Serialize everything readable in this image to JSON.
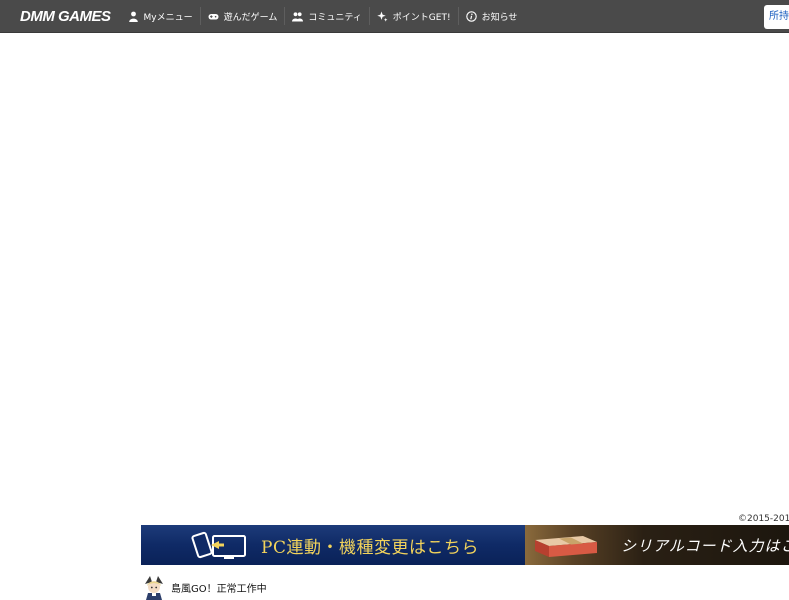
{
  "header": {
    "logo": "DMM GAMES",
    "nav": [
      {
        "label": "Myメニュー",
        "icon": "user-icon"
      },
      {
        "label": "遊んだゲーム",
        "icon": "gamepad-icon"
      },
      {
        "label": "コミュニティ",
        "icon": "community-icon"
      },
      {
        "label": "ポイントGET!",
        "icon": "sparkle-icon"
      },
      {
        "label": "お知らせ",
        "icon": "info-icon"
      }
    ],
    "points_label": "所持"
  },
  "footer": {
    "copyright": "©2015-201",
    "pc_banner_text": "PC連動・機種変更はこちら",
    "serial_banner_text": "シリアルコード入力はこ"
  },
  "status": {
    "text": "島風GO！正常工作中"
  },
  "colors": {
    "topbar": "#4a4a4a",
    "pc_banner": "#0f2a66",
    "pc_banner_text": "#f2d35b",
    "points_text": "#1d5fbf"
  }
}
